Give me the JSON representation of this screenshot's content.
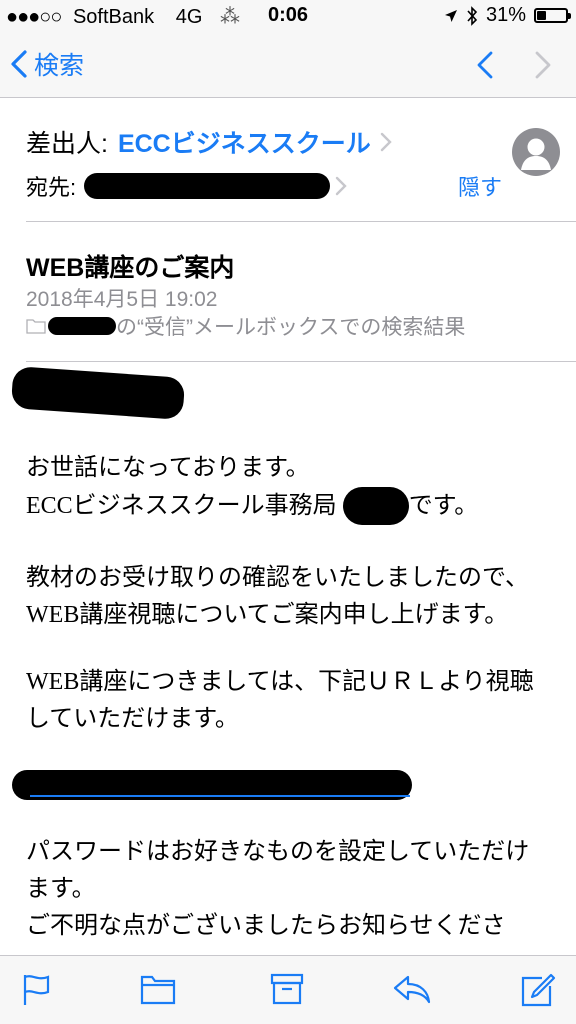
{
  "status_bar": {
    "signal_dots": "●●●○○",
    "carrier": "SoftBank",
    "network": "4G",
    "activity": "⁂",
    "time": "0:06",
    "battery_percent": "31%",
    "battery_level": 0.31
  },
  "nav": {
    "back_label": "検索",
    "accent": "#1a7cf5"
  },
  "header": {
    "from_label": "差出人:",
    "sender": "ECCビジネススクール",
    "to_label": "宛先:",
    "hide_label": "隠す",
    "subject": "WEB講座のご案内",
    "date": "2018年4月5日 19:02",
    "mailbox_note": "の“受信”メールボックスでの検索結果"
  },
  "body": {
    "line1": "お世話になっております。",
    "line2a": "ECCビジネススクール事務局",
    "line2b": "です。",
    "line3": "教材のお受け取りの確認をいたしましたので、",
    "line4": "WEB講座視聴についてご案内申し上げます。",
    "line5": "WEB講座につきましては、下記ＵＲＬより視聴",
    "line6": "していただけます。",
    "line7": "パスワードはお好きなものを設定していただけ",
    "line8": "ます。",
    "line9": "ご不明な点がございましたらお知らせくださ"
  },
  "toolbar": {
    "icons": [
      "flag-icon",
      "folder-icon",
      "archive-icon",
      "reply-icon",
      "compose-icon"
    ]
  }
}
